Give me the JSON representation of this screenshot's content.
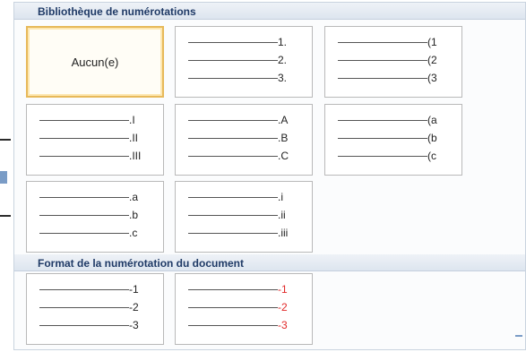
{
  "panel": {
    "library_title": "Bibliothèque de numérotations",
    "document_title": "Format de la numérotation du document",
    "none_label": "Aucun(e)"
  },
  "library": [
    {
      "id": "none",
      "selected": true
    },
    {
      "id": "arabic-dot",
      "items": [
        "1.",
        "2.",
        "3."
      ]
    },
    {
      "id": "arabic-paren",
      "items": [
        "(1",
        "(2",
        "(3"
      ]
    },
    {
      "id": "roman-upper",
      "items": [
        ".I",
        ".II",
        ".III"
      ]
    },
    {
      "id": "alpha-upper",
      "items": [
        ".A",
        ".B",
        ".C"
      ]
    },
    {
      "id": "alpha-lower-paren",
      "items": [
        "(a",
        "(b",
        "(c"
      ]
    },
    {
      "id": "alpha-lower-dot",
      "items": [
        ".a",
        ".b",
        ".c"
      ]
    },
    {
      "id": "roman-lower",
      "items": [
        ".i",
        ".ii",
        ".iii"
      ]
    }
  ],
  "document_formats": [
    {
      "id": "doc-format-1",
      "items": [
        "-1",
        "-2",
        "-3"
      ],
      "color": "#222222"
    },
    {
      "id": "doc-format-2",
      "items": [
        "-1",
        "-2",
        "-3"
      ],
      "color": "#e12828"
    }
  ]
}
